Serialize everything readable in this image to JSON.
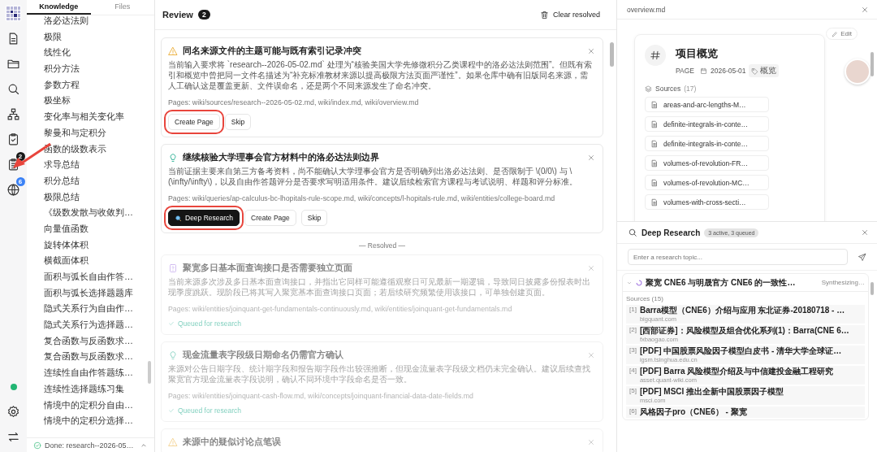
{
  "rail": {
    "top": [
      {
        "kind": "logo"
      },
      {
        "kind": "document"
      },
      {
        "kind": "folder"
      },
      {
        "kind": "search"
      },
      {
        "kind": "hierarchy"
      },
      {
        "kind": "clipboard-check"
      },
      {
        "kind": "clipboard-list",
        "badge": "2",
        "color": "#1a1a1a",
        "pointed": true
      },
      {
        "kind": "globe",
        "badge": "6",
        "color": "#3b82f6",
        "pointed": false
      }
    ],
    "bottom": [
      {
        "kind": "status-dot",
        "color": "#22b573"
      },
      {
        "kind": "gear"
      },
      {
        "kind": "swap"
      }
    ]
  },
  "sidebar": {
    "tabs": [
      {
        "label": "Knowledge",
        "selected": true
      },
      {
        "label": "Files",
        "selected": false
      }
    ],
    "items": [
      "洛必达法则",
      "极限",
      "线性化",
      "积分方法",
      "参数方程",
      "极坐标",
      "变化率与相关变化率",
      "黎曼和与定积分",
      "函数的级数表示",
      "求导总结",
      "积分总结",
      "极限总结",
      "《级数发散与收敛判…",
      "向量值函数",
      "旋转体体积",
      "横截面体积",
      "面积与弧长自由作答…",
      "面积与弧长选择题题库",
      "隐式关系行为自由作…",
      "隐式关系行为选择题…",
      "复合函数与反函数求…",
      "复合函数与反函数求…",
      "连续性自由作答题练…",
      "连续性选择题练习集",
      "情境中的定积分自由…",
      "情境中的定积分选择…"
    ],
    "footer": "Done: research--2026-05…"
  },
  "review": {
    "title": "Review",
    "count": "2",
    "clear_button": "Clear resolved",
    "open": [
      {
        "kind": "warning",
        "title": "同名来源文件的主题可能与既有索引记录冲突",
        "body": "当前输入要求将 `research--2026-05-02.md` 处理为“核验美国大学先修微积分乙类课程中的洛必达法则范围”。但既有索引和概览中曾把同一文件名描述为“补充标准教材来源以提高极限方法页面严谨性”。如果仓库中确有旧版同名来源，需人工确认这是覆盖更新、文件误命名，还是两个不同来源发生了命名冲突。",
        "pages": "Pages: wiki/sources/research--2026-05-02.md, wiki/index.md, wiki/overview.md",
        "actions": [
          {
            "label": "Create Page",
            "kind": "secondary",
            "highlighted": true
          },
          {
            "label": "Skip",
            "kind": "secondary",
            "highlighted": false
          }
        ]
      },
      {
        "kind": "idea",
        "title": "继续核验大学理事会官方材料中的洛必达法则边界",
        "body": "当前证据主要来自第三方备考资料，尚不能确认大学理事会官方是否明确列出洛必达法则、是否限制于 \\(0/0\\) 与 \\(\\infty/\\infty\\)，以及自由作答题评分是否要求写明适用条件。建议后续检索官方课程与考试说明、样题和评分标准。",
        "pages": "Pages: wiki/queries/ap-calculus-bc-lhopitals-rule-scope.md, wiki/concepts/l-hopitals-rule.md, wiki/entities/college-board.md",
        "actions": [
          {
            "label": "Deep Research",
            "kind": "primary",
            "highlighted": true
          },
          {
            "label": "Create Page",
            "kind": "secondary",
            "highlighted": false
          },
          {
            "label": "Skip",
            "kind": "secondary",
            "highlighted": false
          }
        ]
      }
    ],
    "resolved_label": "— Resolved —",
    "resolved": [
      {
        "kind": "question",
        "title": "聚宽多日基本面查询接口是否需要独立页面",
        "body": "当前来源多次涉及多日基本面查询接口，并指出它同样可能遵循观察日可见最新一期逻辑，导致同日披露多份报表时出现季度跳跃。现阶段已将其写入聚宽基本面查询接口页面；若后续研究频繁使用该接口，可单独创建页面。",
        "pages": "Pages: wiki/entities/joinquant-get-fundamentals-continuously.md, wiki/entities/joinquant-get-fundamentals.md",
        "status": "Queued for research"
      },
      {
        "kind": "idea",
        "title": "现金流量表字段级日期命名仍需官方确认",
        "body": "来源对公告日期字段、统计期字段和报告期字段作出较强推断，但现金流量表字段级文档仍未完全确认。建议后续查找聚宽官方现金流量表字段说明，确认不同环境中字段命名是否一致。",
        "pages": "Pages: wiki/entities/joinquant-cash-flow.md, wiki/concepts/joinquant-financial-data-date-fields.md",
        "status": "Queued for research"
      },
      {
        "kind": "warning",
        "title": "来源中的疑似讨论点笔误"
      }
    ]
  },
  "preview": {
    "file": "overview.md",
    "edit": "Edit",
    "title": "项目概览",
    "type": "PAGE",
    "date": "2026-05-01",
    "tag": "概览",
    "sources_label": "Sources",
    "sources_count": "(17)",
    "sources": [
      "areas-and-arc-lengths-M…",
      "definite-integrals-in-conte…",
      "definite-integrals-in-conte…",
      "volumes-of-revolution-FR…",
      "volumes-of-revolution-MC…",
      "volumes-with-cross-secti…"
    ]
  },
  "research": {
    "title": "Deep Research",
    "badge": "3 active, 3 queued",
    "placeholder": "Enter a research topic...",
    "task": {
      "title": "聚宽 CNE6 与明晟官方 CNE6 的一致性…",
      "status": "Synthesizing…",
      "expanded": true,
      "sources_label": "Sources (15)",
      "sources": [
        {
          "index": "[1]",
          "title": "Barra模型（CNE6）介绍与应用 东北证券-20180718 - …",
          "domain": "bigquant.com"
        },
        {
          "index": "[2]",
          "title": "[西部证券]：风险模型及组合优化系列(1)：Barra(CNE 6…",
          "domain": "fxbaogao.com"
        },
        {
          "index": "[3]",
          "title": "[PDF] 中国股票风险因子模型白皮书 - 清华大学全球证…",
          "domain": "igsm.tsinghua.edu.cn"
        },
        {
          "index": "[4]",
          "title": "[PDF] Barra 风险模型介绍及与中信建投金融工程研究",
          "domain": "asset.quant-wiki.com"
        },
        {
          "index": "[5]",
          "title": "[PDF] MSCI 推出全新中国股票因子模型",
          "domain": "msci.com"
        },
        {
          "index": "[6]",
          "title": "风格因子pro（CNE6） - 聚宽"
        }
      ]
    }
  }
}
